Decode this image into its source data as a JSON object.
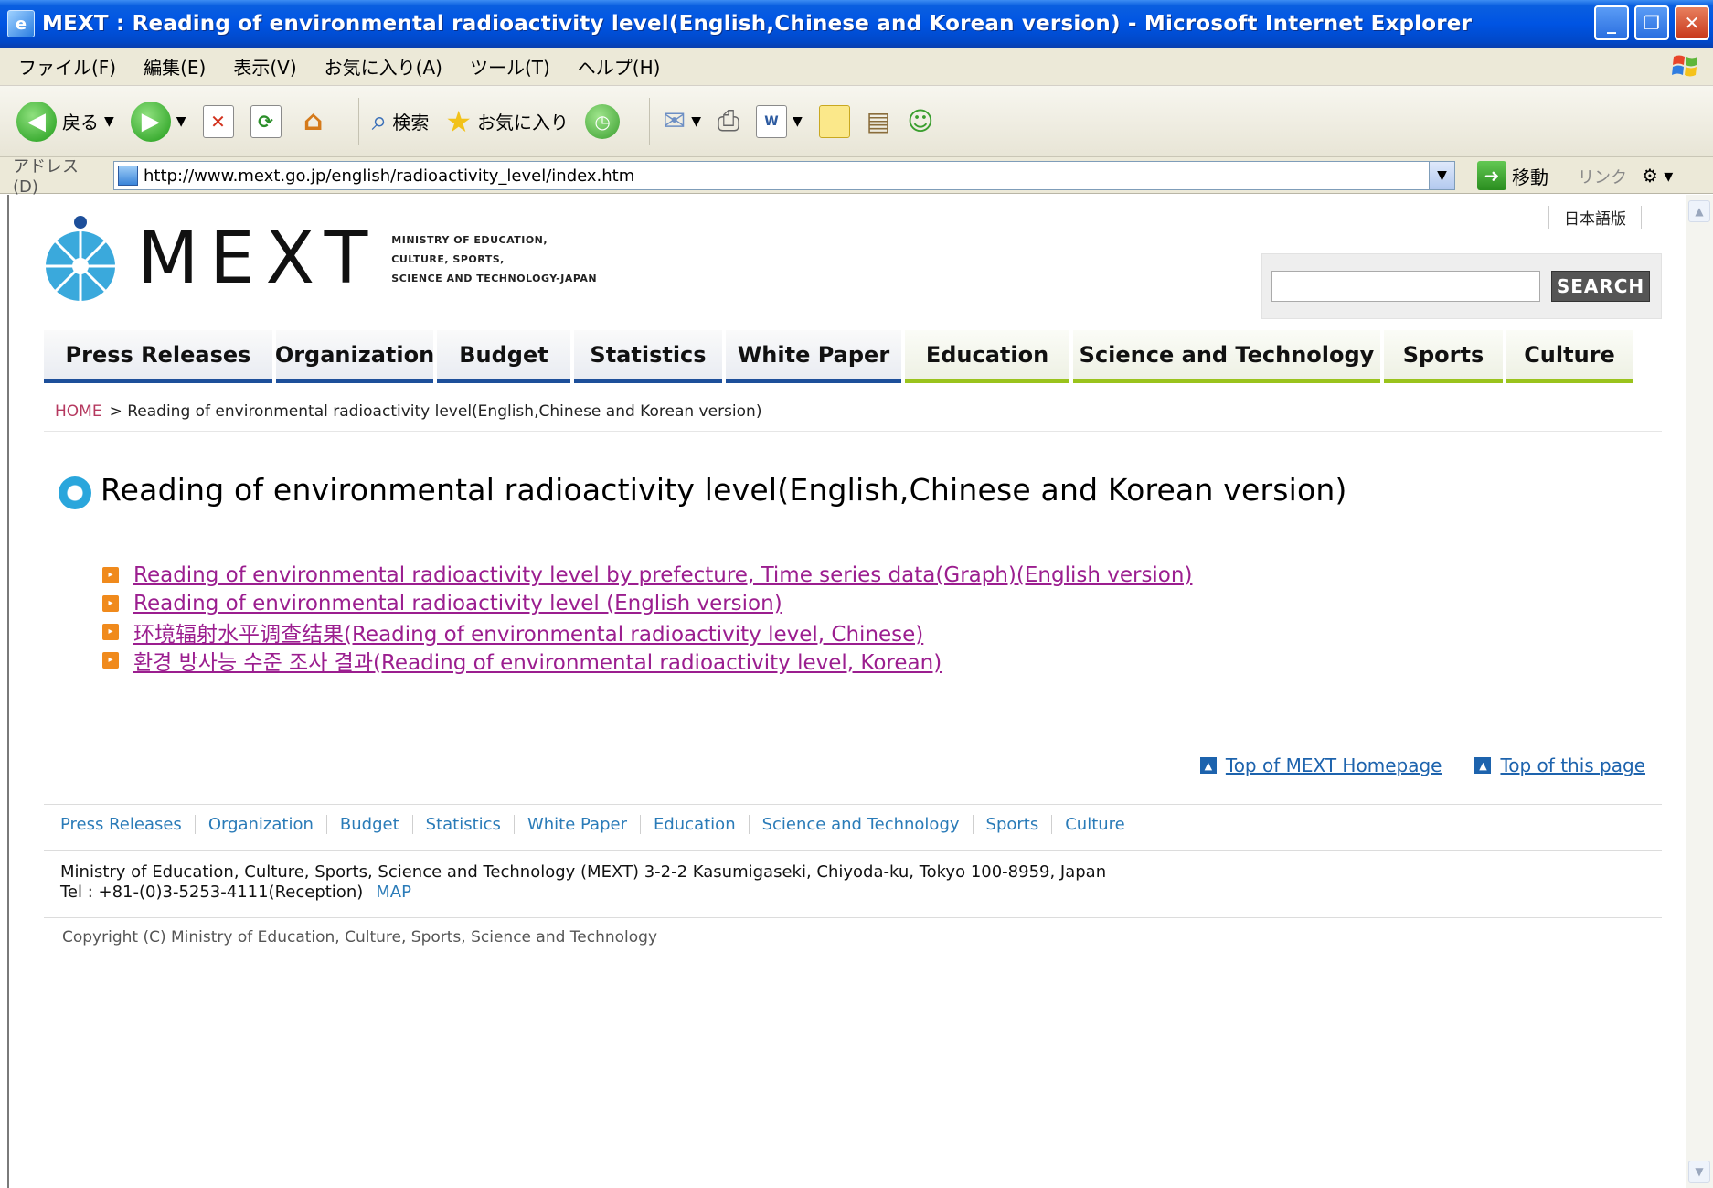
{
  "window": {
    "title": "MEXT : Reading of environmental radioactivity level(English,Chinese and Korean version) - Microsoft Internet Explorer",
    "min_label": "_",
    "max_label": "❐",
    "close_label": "✕"
  },
  "menubar": {
    "items": [
      "ファイル(F)",
      "編集(E)",
      "表示(V)",
      "お気に入り(A)",
      "ツール(T)",
      "ヘルプ(H)"
    ]
  },
  "toolbar": {
    "back_label": "戻る",
    "search_label": "検索",
    "favorites_label": "お気に入り"
  },
  "addressbar": {
    "label": "アドレス(D)",
    "url": "http://www.mext.go.jp/english/radioactivity_level/index.htm",
    "go_label": "移動",
    "links_label": "リンク"
  },
  "site": {
    "lang_link": "日本語版",
    "logo_text": "MEXT",
    "logo_sub": [
      "MINISTRY OF EDUCATION,",
      "CULTURE, SPORTS,",
      "SCIENCE AND TECHNOLOGY-JAPAN"
    ],
    "search_button": "SEARCH",
    "search_value": ""
  },
  "nav": [
    {
      "label": "Press Releases",
      "accent": "blue"
    },
    {
      "label": "Organization",
      "accent": "blue"
    },
    {
      "label": "Budget",
      "accent": "blue"
    },
    {
      "label": "Statistics",
      "accent": "blue"
    },
    {
      "label": "White Paper",
      "accent": "blue"
    },
    {
      "label": "Education",
      "accent": "green"
    },
    {
      "label": "Science and Technology",
      "accent": "green"
    },
    {
      "label": "Sports",
      "accent": "green"
    },
    {
      "label": "Culture",
      "accent": "green"
    }
  ],
  "breadcrumb": {
    "home": "HOME",
    "current": "> Reading of environmental radioactivity level(English,Chinese and Korean version)"
  },
  "page_title": "Reading of environmental radioactivity level(English,Chinese and Korean version)",
  "links": [
    "Reading of environmental radioactivity level by prefecture, Time series data(Graph)(English version)",
    "Reading of environmental radioactivity level (English version)",
    "环境辐射水平调查结果(Reading of environmental radioactivity level, Chinese)",
    "환경 방사능 수준 조사 결과(Reading of environmental radioactivity level, Korean)"
  ],
  "top_links": {
    "mext_home": "Top of MEXT Homepage",
    "this_page": "Top of this page"
  },
  "footer": {
    "nav": [
      "Press Releases",
      "Organization",
      "Budget",
      "Statistics",
      "White Paper",
      "Education",
      "Science and Technology",
      "Sports",
      "Culture"
    ],
    "address_line": "Ministry of Education, Culture, Sports, Science and Technology (MEXT)  3-2-2 Kasumigaseki, Chiyoda-ku, Tokyo 100-8959, Japan",
    "tel_line": "Tel : +81-(0)3-5253-4111(Reception)",
    "map_label": "MAP",
    "copyright": "Copyright (C) Ministry of Education, Culture, Sports, Science and Technology"
  },
  "colors": {
    "nav_blue": "#1d4f9a",
    "nav_green": "#9ac31c",
    "link_visited": "#9b1e8f",
    "link_blue": "#1d63ad",
    "title_bar": "#0054e3"
  }
}
